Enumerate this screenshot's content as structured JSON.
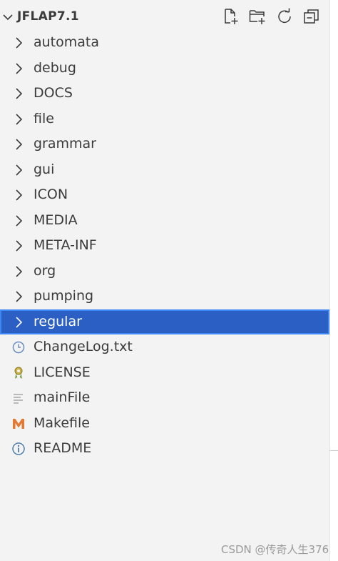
{
  "explorer": {
    "title": "JFLAP7.1",
    "actions": [
      {
        "icon": "new-file-icon"
      },
      {
        "icon": "new-folder-icon"
      },
      {
        "icon": "refresh-icon"
      },
      {
        "icon": "collapse-all-icon"
      }
    ]
  },
  "tree": {
    "folders": [
      {
        "label": "automata"
      },
      {
        "label": "debug"
      },
      {
        "label": "DOCS"
      },
      {
        "label": "file"
      },
      {
        "label": "grammar"
      },
      {
        "label": "gui"
      },
      {
        "label": "ICON"
      },
      {
        "label": "MEDIA"
      },
      {
        "label": "META-INF"
      },
      {
        "label": "org"
      },
      {
        "label": "pumping"
      },
      {
        "label": "regular",
        "selected": true
      }
    ],
    "files": [
      {
        "label": "ChangeLog.txt",
        "icon": "clock-icon"
      },
      {
        "label": "LICENSE",
        "icon": "license-icon"
      },
      {
        "label": "mainFile",
        "icon": "text-file-icon"
      },
      {
        "label": "Makefile",
        "icon": "makefile-icon"
      },
      {
        "label": "README",
        "icon": "info-icon"
      }
    ]
  },
  "colors": {
    "panel_bg": "#f3f3f3",
    "selection_bg": "#2b5fc4",
    "selection_border": "#3f86f5",
    "text": "#3b3b3b",
    "makefile_icon": "#e37933",
    "info_icon": "#4e7ea8",
    "license_icon": "#b5a03a"
  },
  "watermark": "CSDN @传奇人生376"
}
